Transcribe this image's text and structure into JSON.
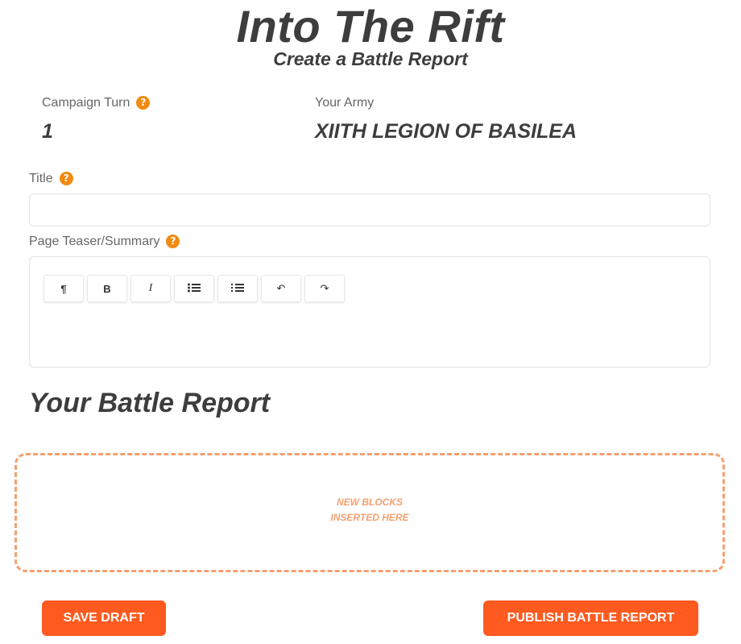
{
  "header": {
    "title": "Into The Rift",
    "subtitle": "Create a Battle Report"
  },
  "info": {
    "campaign_turn_label": "Campaign Turn",
    "campaign_turn_value": "1",
    "army_label": "Your Army",
    "army_value": "XIITH LEGION OF BASILEA"
  },
  "form": {
    "title_label": "Title",
    "title_value": "",
    "teaser_label": "Page Teaser/Summary",
    "toolbar": [
      {
        "name": "paragraph-icon",
        "glyph": "¶"
      },
      {
        "name": "bold-icon",
        "glyph": "B"
      },
      {
        "name": "italic-icon",
        "glyph": "I"
      },
      {
        "name": "bullet-list-icon",
        "glyph": "list"
      },
      {
        "name": "ordered-list-icon",
        "glyph": "list"
      },
      {
        "name": "undo-icon",
        "glyph": "↶"
      },
      {
        "name": "redo-icon",
        "glyph": "↷"
      }
    ]
  },
  "report": {
    "heading": "Your Battle Report",
    "drop_zone_line1": "NEW BLOCKS",
    "drop_zone_line2": "INSERTED HERE"
  },
  "actions": {
    "save_label": "SAVE DRAFT",
    "publish_label": "PUBLISH BATTLE REPORT"
  },
  "colors": {
    "accent": "#ff5a1f",
    "help_icon": "#f18a11",
    "drop_zone_border": "#f4a070",
    "heading_text": "#3d3d3d"
  }
}
